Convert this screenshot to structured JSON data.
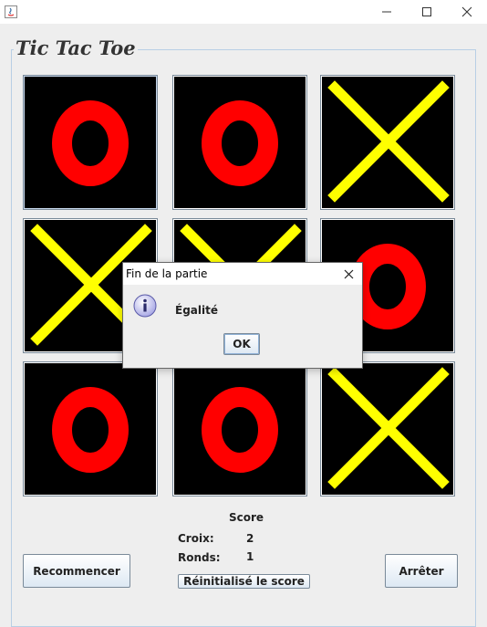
{
  "window": {
    "title": "",
    "controls": [
      "minimize-icon",
      "maximize-icon",
      "close-icon"
    ]
  },
  "game": {
    "title": "Tic Tac Toe",
    "board": [
      [
        "O",
        "O",
        "X"
      ],
      [
        "X",
        "X",
        "O"
      ],
      [
        "O",
        "O",
        "X"
      ]
    ],
    "colors": {
      "cell_bg": "#000000",
      "o_mark": "#ff0000",
      "x_mark": "#ffff00"
    }
  },
  "score": {
    "title": "Score",
    "croix_label": "Croix:",
    "croix_value": "2",
    "ronds_label": "Ronds:",
    "ronds_value": "1",
    "reset_label": "Réinitialisé le score"
  },
  "buttons": {
    "restart_label": "Recommencer",
    "stop_label": "Arrêter"
  },
  "dialog": {
    "title": "Fin de la partie",
    "message": "Égalité",
    "ok_label": "OK",
    "icon": "info-icon"
  }
}
